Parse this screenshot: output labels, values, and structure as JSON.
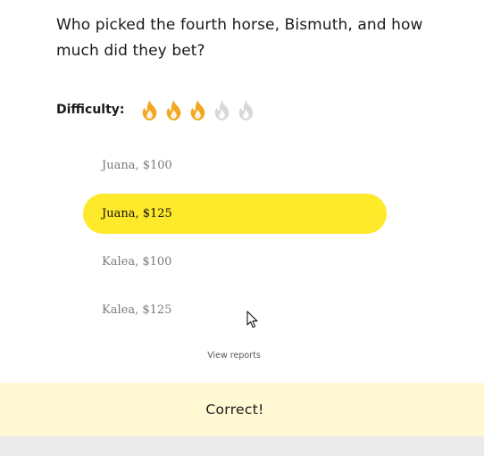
{
  "question": "Who picked the fourth horse, Bismuth, and how much did they bet?",
  "difficulty": {
    "label": "Difficulty:",
    "level": 3,
    "max": 5,
    "icon": "flame-icon",
    "active_color": "#f1a722",
    "inactive_color": "#d9d9d9"
  },
  "options": [
    {
      "label": "Juana, $100",
      "selected": false
    },
    {
      "label": "Juana, $125",
      "selected": true
    },
    {
      "label": "Kalea, $100",
      "selected": false
    },
    {
      "label": "Kalea, $125",
      "selected": false
    }
  ],
  "selected_color": "#ffe92b",
  "view_reports": "View reports",
  "result": {
    "text": "Correct!",
    "background": "#fff8d3"
  }
}
